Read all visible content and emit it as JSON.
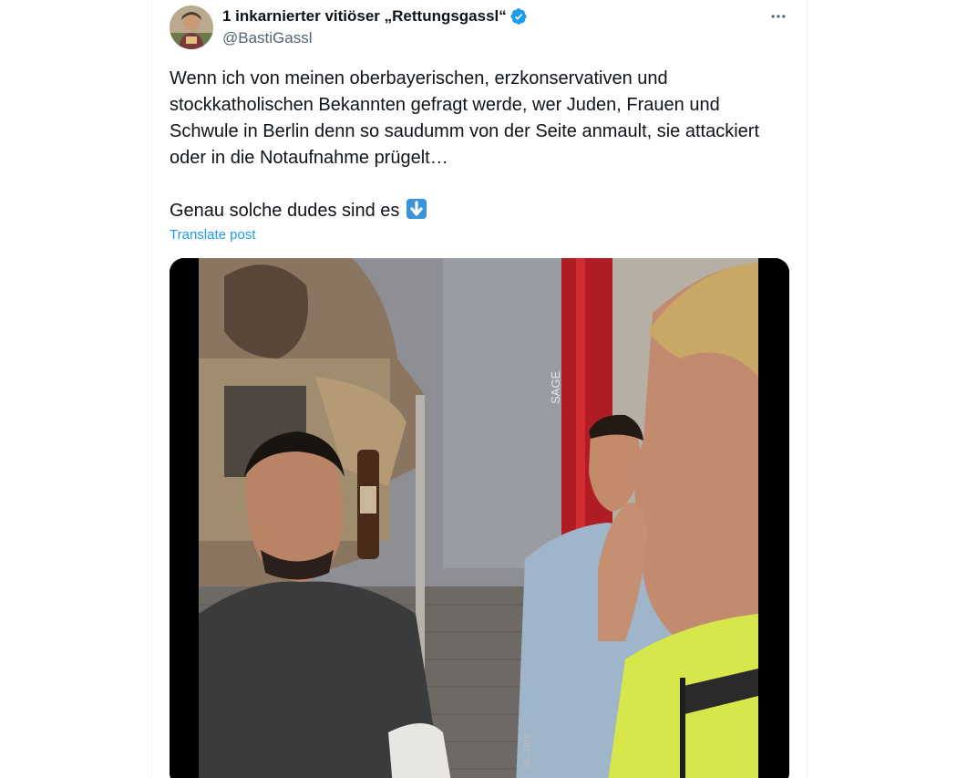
{
  "tweet": {
    "author": {
      "display_name": "1 inkarnierter vitiöser „Rettungsgassl“",
      "handle": "@BastiGassl",
      "verified": true
    },
    "text_paragraph_1": "Wenn ich von meinen oberbayerischen, erzkonservativen und stockkatholischen Bekannten gefragt werde, wer Juden, Frauen und Schwule in Berlin denn so saudumm von der Seite anmault, sie attackiert oder in die Notaufnahme prügelt…",
    "text_paragraph_2": "Genau solche dudes sind es",
    "emoji": "down-arrow-emoji",
    "translate_label": "Translate post",
    "watermark": "ok.com/",
    "sign_text": "SAGE"
  },
  "colors": {
    "text_primary": "#0f1419",
    "text_secondary": "#536471",
    "link": "#1d9bf0",
    "verified": "#1d9bf0",
    "border": "#eff3f4"
  },
  "icons": {
    "more": "more-horizontal-icon",
    "verified": "verified-badge-icon"
  }
}
